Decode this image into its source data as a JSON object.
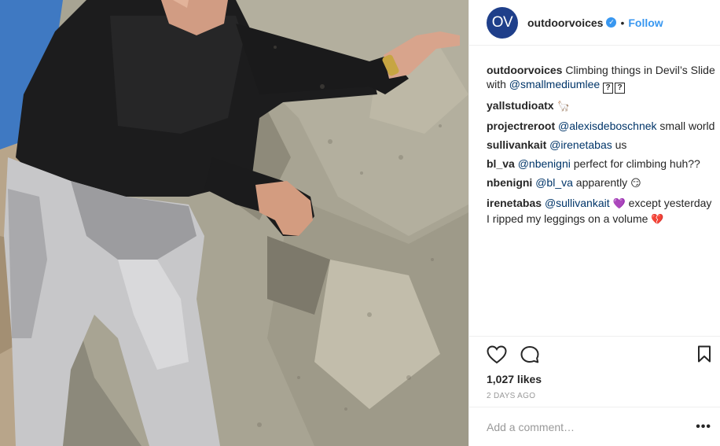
{
  "post": {
    "author": "outdoorvoices",
    "avatar_text": "OV",
    "verified_icon": "verified-badge-icon",
    "follow_label": "Follow",
    "separator": "•"
  },
  "caption": {
    "user": "outdoorvoices",
    "text": "Climbing things in Devil’s Slide with",
    "mention": "@smallmediumlee"
  },
  "comments": [
    {
      "user": "yallstudioatx",
      "mention": "",
      "text": "",
      "emoji": "🦙"
    },
    {
      "user": "projectreroot",
      "mention": "@alexisdeboschnek",
      "text": "small world",
      "emoji": ""
    },
    {
      "user": "sullivankait",
      "mention": "@irenetabas",
      "text": "us",
      "emoji": ""
    },
    {
      "user": "bl_va",
      "mention": "@nbenigni",
      "text": "perfect for climbing huh??",
      "emoji": ""
    },
    {
      "user": "nbenigni",
      "mention": "@bl_va",
      "text": "apparently",
      "emoji": "😏"
    },
    {
      "user": "irenetabas",
      "mention": "@sullivankait",
      "text": "except yesterday I ripped my leggings on a volume",
      "emoji": "💜",
      "emoji_end": "💔"
    }
  ],
  "actions": {
    "likes": "1,027 likes",
    "time_ago": "2 DAYS AGO"
  },
  "add_comment": {
    "placeholder": "Add a comment…",
    "more": "•••"
  },
  "colors": {
    "link": "#003569",
    "follow": "#3897f0",
    "avatar_bg": "#1f3f8a"
  }
}
